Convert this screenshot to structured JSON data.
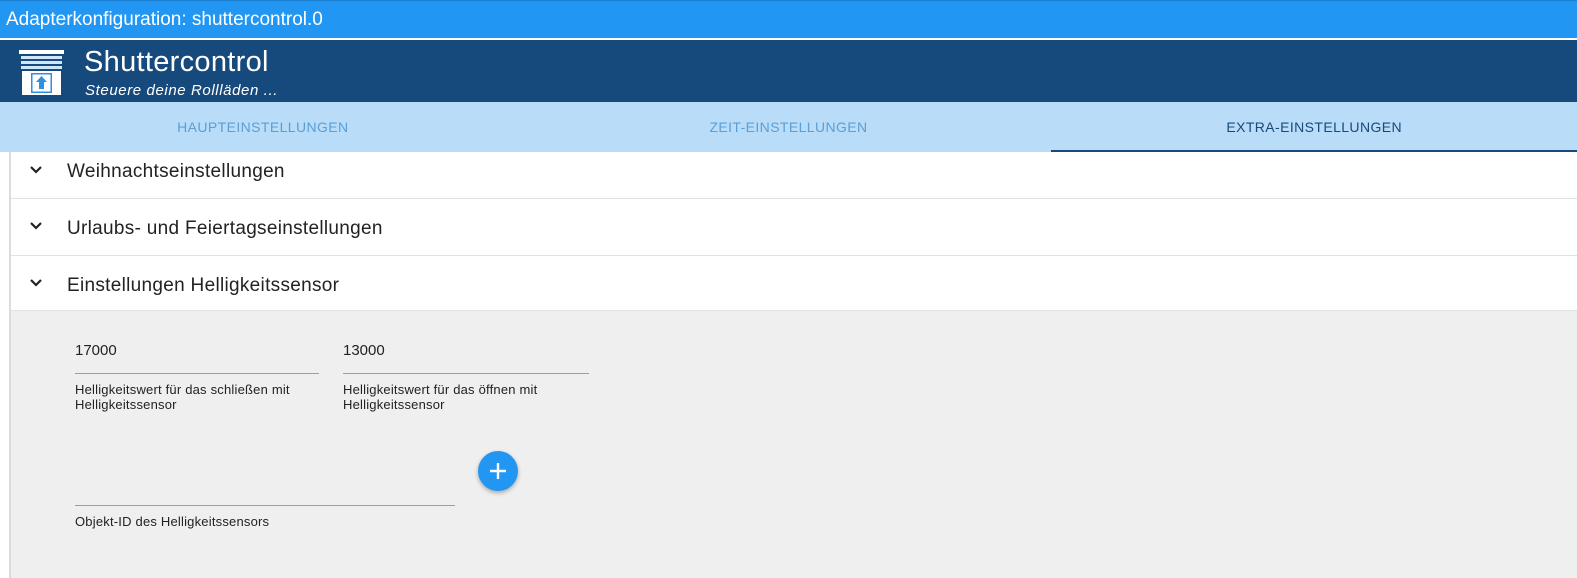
{
  "window": {
    "title": "Adapterkonfiguration: shuttercontrol.0"
  },
  "header": {
    "app_name": "Shuttercontrol",
    "subtitle": "Steuere deine Rollläden ...",
    "logo_icon": "shutter-logo-icon"
  },
  "tabs": [
    {
      "label": "HAUPTEINSTELLUNGEN",
      "active": false
    },
    {
      "label": "ZEIT-EINSTELLUNGEN",
      "active": false
    },
    {
      "label": "EXTRA-EINSTELLUNGEN",
      "active": true
    }
  ],
  "accordion": [
    {
      "title": "Weihnachtseinstellungen",
      "icon": "chevron-down-icon"
    },
    {
      "title": "Urlaubs- und Feiertagseinstellungen",
      "icon": "chevron-down-icon"
    },
    {
      "title": "Einstellungen Helligkeitssensor",
      "icon": "chevron-down-icon",
      "expanded": true
    }
  ],
  "brightness": {
    "close_value": "17000",
    "close_label": "Helligkeitswert für das schließen mit Helligkeitssensor",
    "open_value": "13000",
    "open_label": "Helligkeitswert für das öffnen mit Helligkeitssensor",
    "object_id_value": "",
    "object_id_label": "Objekt-ID des Helligkeitssensors",
    "add_icon": "plus-icon"
  },
  "colors": {
    "titlebar": "#2196f3",
    "header": "#174a7c",
    "tabs_bg": "#b9dcf8",
    "tab_inactive": "#5a9fd6",
    "tab_active": "#174a7c",
    "panel_bg": "#efefef",
    "fab": "#2196f3"
  }
}
